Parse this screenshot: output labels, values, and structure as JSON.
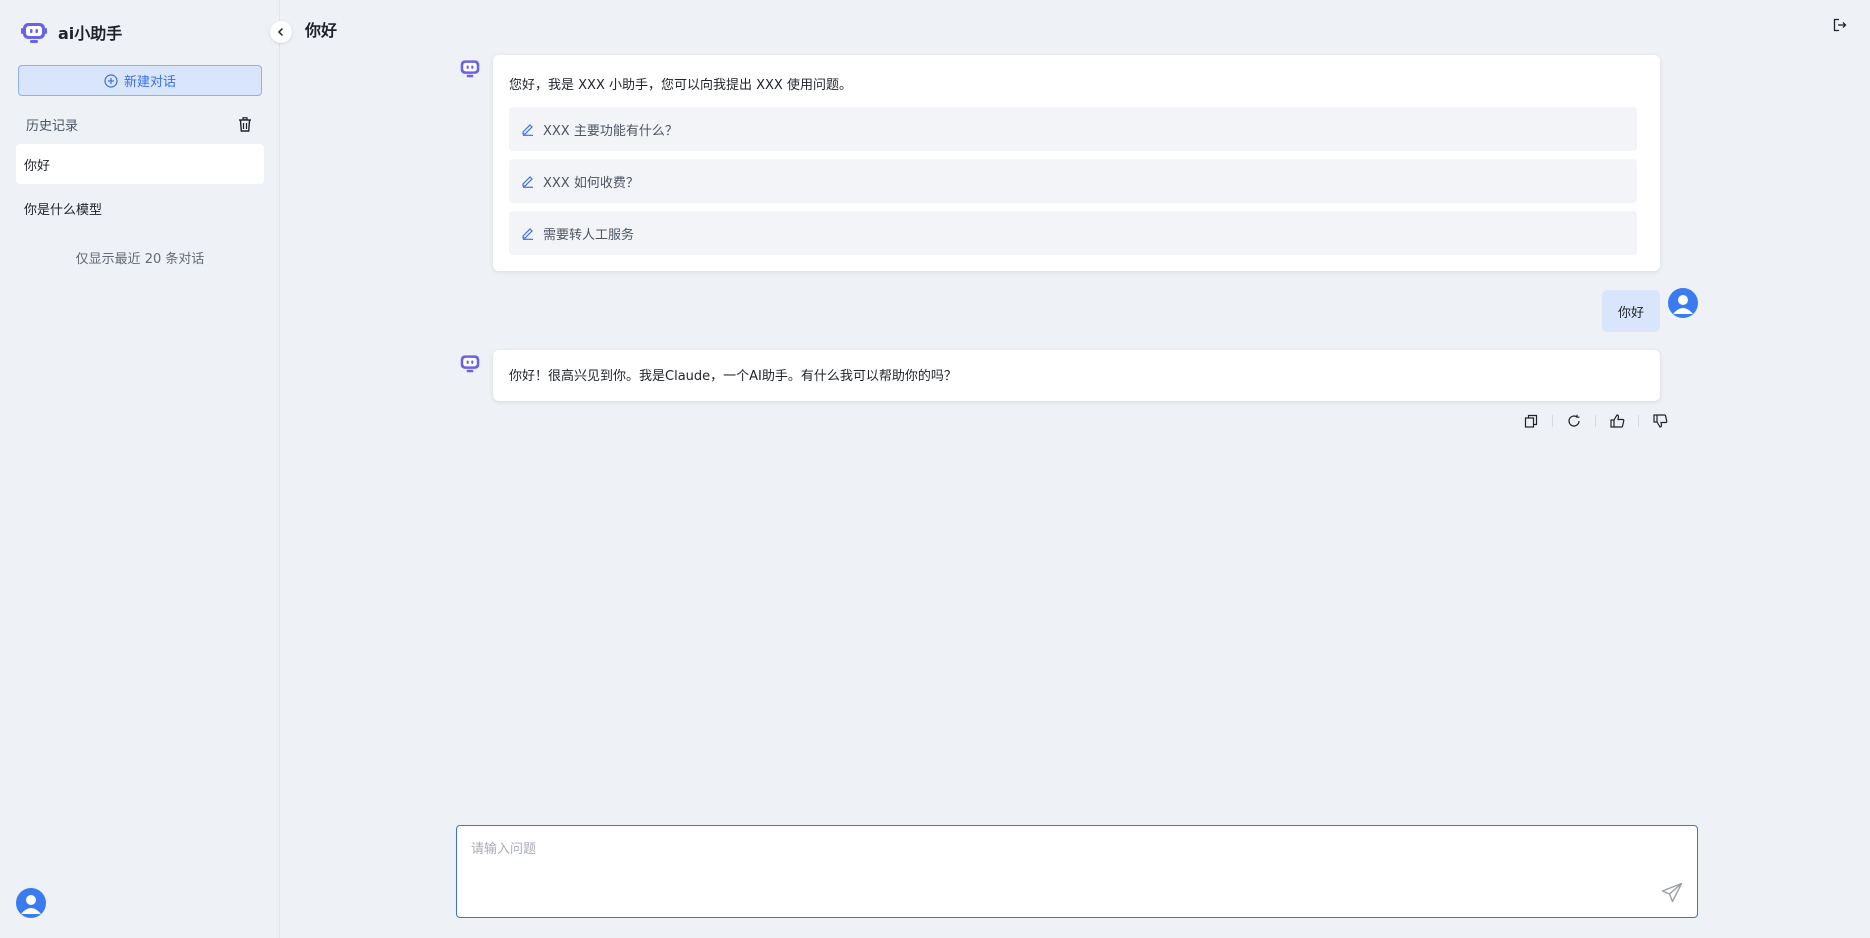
{
  "app": {
    "title": "ai小助手",
    "logo_icon": "robot-icon",
    "accent_color": "#3a6fe8"
  },
  "sidebar": {
    "new_chat_label": "新建对话",
    "history_title": "历史记录",
    "items": [
      {
        "label": "你好",
        "active": true
      },
      {
        "label": "你是什么模型",
        "active": false
      }
    ],
    "note": "仅显示最近 20 条对话"
  },
  "header": {
    "title": "你好",
    "logout_icon": "logout-icon"
  },
  "messages": {
    "welcome": {
      "text": "您好，我是 XXX 小助手，您可以向我提出 XXX 使用问题。",
      "suggestions": [
        "XXX 主要功能有什么？",
        "XXX 如何收费？",
        "需要转人工服务"
      ]
    },
    "user_message": "你好",
    "reply": "你好！很高兴见到你。我是Claude，一个AI助手。有什么我可以帮助你的吗？",
    "actions": [
      "copy-icon",
      "refresh-icon",
      "thumbs-up-icon",
      "thumbs-down-icon"
    ]
  },
  "input": {
    "placeholder": "请输入问题",
    "value": ""
  }
}
